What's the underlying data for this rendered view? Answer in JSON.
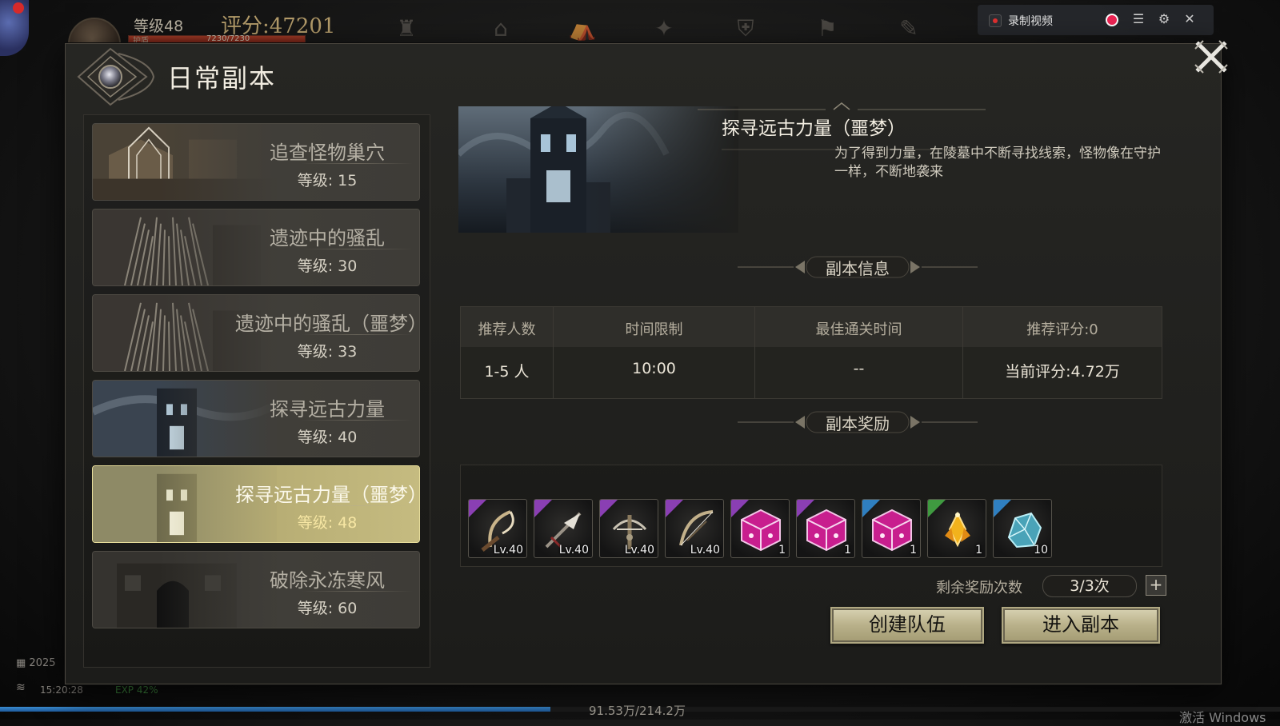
{
  "hud": {
    "level": "等级48",
    "score": "评分:47201",
    "hp_label": "护盾",
    "hp_text": "7230/7230",
    "record_label": "录制视频",
    "date": "2025",
    "time": "15:20:28",
    "exp_percent": "EXP 42%",
    "exp_value": "91.53万/214.2万",
    "exp_fill_fraction": 0.43,
    "watermark": "激活 Windows"
  },
  "dialog": {
    "title": "日常副本",
    "dungeons": [
      {
        "name": "追查怪物巢穴",
        "level": "等级: 15",
        "selected": false
      },
      {
        "name": "遗迹中的骚乱",
        "level": "等级: 30",
        "selected": false
      },
      {
        "name": "遗迹中的骚乱（噩梦）",
        "level": "等级: 33",
        "selected": false
      },
      {
        "name": "探寻远古力量",
        "level": "等级: 40",
        "selected": false
      },
      {
        "name": "探寻远古力量（噩梦）",
        "level": "等级: 48",
        "selected": true
      },
      {
        "name": "破除永冻寒风",
        "level": "等级: 60",
        "selected": false
      }
    ],
    "detail": {
      "title": "探寻远古力量（噩梦）",
      "description": "为了得到力量，在陵墓中不断寻找线索，怪物像在守护一样，不断地袭来"
    },
    "info_section_label": "副本信息",
    "info_table": {
      "headers": [
        "推荐人数",
        "时间限制",
        "最佳通关时间",
        "推荐评分:0"
      ],
      "values": [
        "1-5 人",
        "10:00",
        "--",
        "当前评分:4.72万"
      ]
    },
    "reward_section_label": "副本奖励",
    "rewards": [
      {
        "icon": "scythe-icon",
        "qty": "Lv.40",
        "rarity_color": "#8a3fb3"
      },
      {
        "icon": "spear-icon",
        "qty": "Lv.40",
        "rarity_color": "#8a3fb3"
      },
      {
        "icon": "crossbow-icon",
        "qty": "Lv.40",
        "rarity_color": "#8a3fb3"
      },
      {
        "icon": "bow-icon",
        "qty": "Lv.40",
        "rarity_color": "#8a3fb3"
      },
      {
        "icon": "gem-chest-icon",
        "qty": "1",
        "rarity_color": "#8a3fb3"
      },
      {
        "icon": "gem-chest-icon",
        "qty": "1",
        "rarity_color": "#8a3fb3"
      },
      {
        "icon": "gem-chest-icon",
        "qty": "1",
        "rarity_color": "#2f7fc0"
      },
      {
        "icon": "gold-crystal-icon",
        "qty": "1",
        "rarity_color": "#3f9a40"
      },
      {
        "icon": "blue-ore-icon",
        "qty": "10",
        "rarity_color": "#2f7fc0"
      }
    ],
    "remaining_label": "剩余奖励次数",
    "remaining_value": "3/3次",
    "create_team_label": "创建队伍",
    "enter_dungeon_label": "进入副本"
  }
}
